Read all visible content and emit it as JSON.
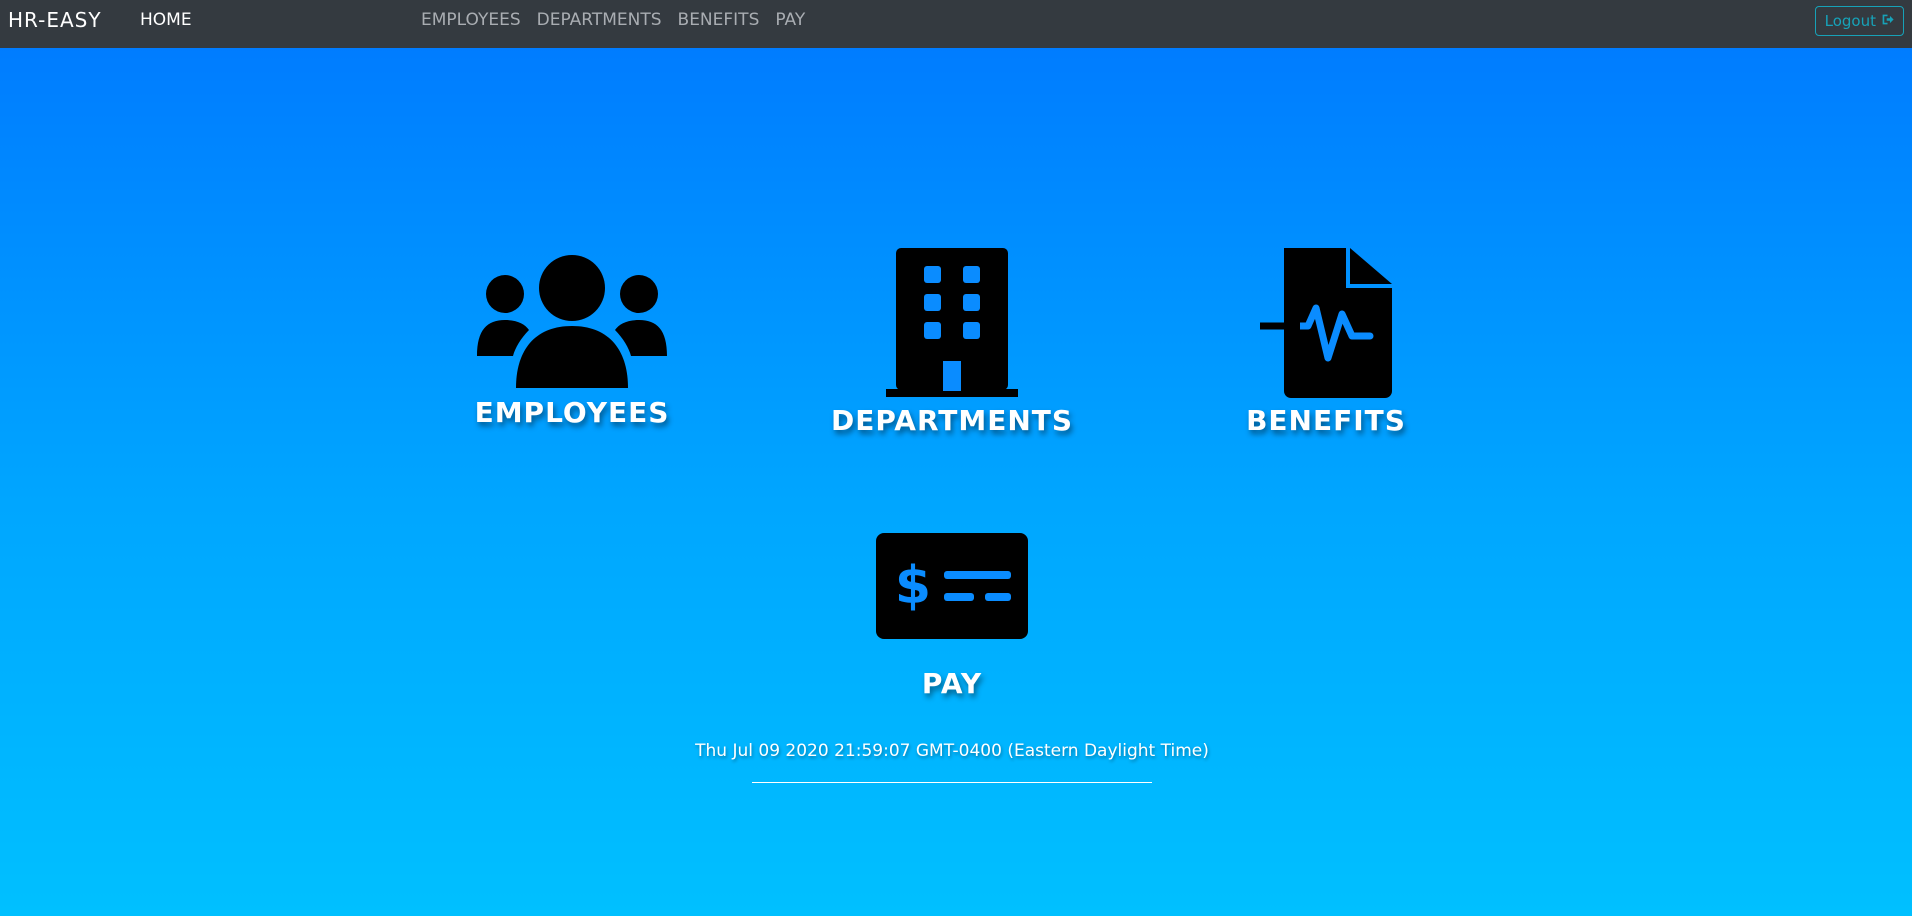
{
  "navbar": {
    "brand": "HR-EASY",
    "home_label": "HOME",
    "links": [
      {
        "label": "EMPLOYEES"
      },
      {
        "label": "DEPARTMENTS"
      },
      {
        "label": "BENEFITS"
      },
      {
        "label": "PAY"
      }
    ],
    "logout_label": "Logout",
    "logout_icon": "sign-out-icon"
  },
  "tiles": [
    {
      "label": "EMPLOYEES",
      "icon": "users-icon"
    },
    {
      "label": "DEPARTMENTS",
      "icon": "building-icon"
    },
    {
      "label": "BENEFITS",
      "icon": "file-medical-icon"
    },
    {
      "label": "PAY",
      "icon": "money-check-icon"
    }
  ],
  "footer": {
    "datetime": "Thu Jul 09 2020 21:59:07 GMT-0400 (Eastern Daylight Time)"
  },
  "colors": {
    "navbar_bg": "#343a40",
    "accent": "#17a2b8",
    "gradient_top": "#0078ff",
    "gradient_bottom": "#00c0ff"
  }
}
